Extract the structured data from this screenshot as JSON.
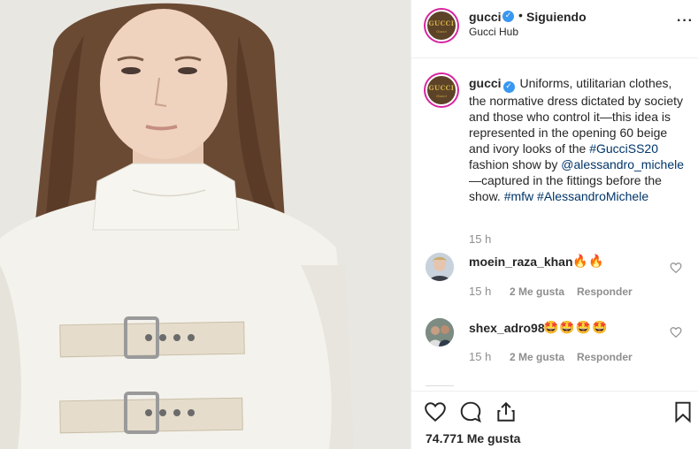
{
  "post": {
    "author": {
      "username": "gucci",
      "verified": true,
      "follow_status": "Siguiendo",
      "location": "Gucci Hub",
      "avatar_text": "GUCCI",
      "avatar_subtext": "Gucci"
    },
    "caption": {
      "username": "gucci",
      "text_1": "Uniforms, utilitarian clothes, the normative dress dictated by society and those who control it—this idea is represented in the opening 60 beige and ivory looks of the",
      "hashtag_1": "#GucciSS20",
      "text_2": "fashion show by",
      "mention": "@alessandro_michele",
      "text_3": "—captured in the fittings before the show.",
      "hashtag_2": "#mfw",
      "hashtag_3": "#AlessandroMichele",
      "time": "15 h"
    },
    "comments": [
      {
        "username": "moein_raza_khan",
        "text": "🔥🔥",
        "time": "15 h",
        "likes": "2 Me gusta",
        "reply_label": "Responder"
      },
      {
        "username": "shex_adro98",
        "text": "🤩🤩🤩🤩",
        "time": "15 h",
        "likes": "2 Me gusta",
        "reply_label": "Responder"
      }
    ],
    "likes_count": "74.771 Me gusta",
    "icons": {
      "more": "more-options-icon",
      "like": "heart-icon",
      "comment": "comment-icon",
      "share": "share-icon",
      "save": "bookmark-icon",
      "verified": "verified-badge-icon"
    },
    "colors": {
      "link": "#003569",
      "verified": "#3897f0",
      "secondary_text": "#8e8e8e",
      "story_ring": "#d6249f"
    }
  }
}
